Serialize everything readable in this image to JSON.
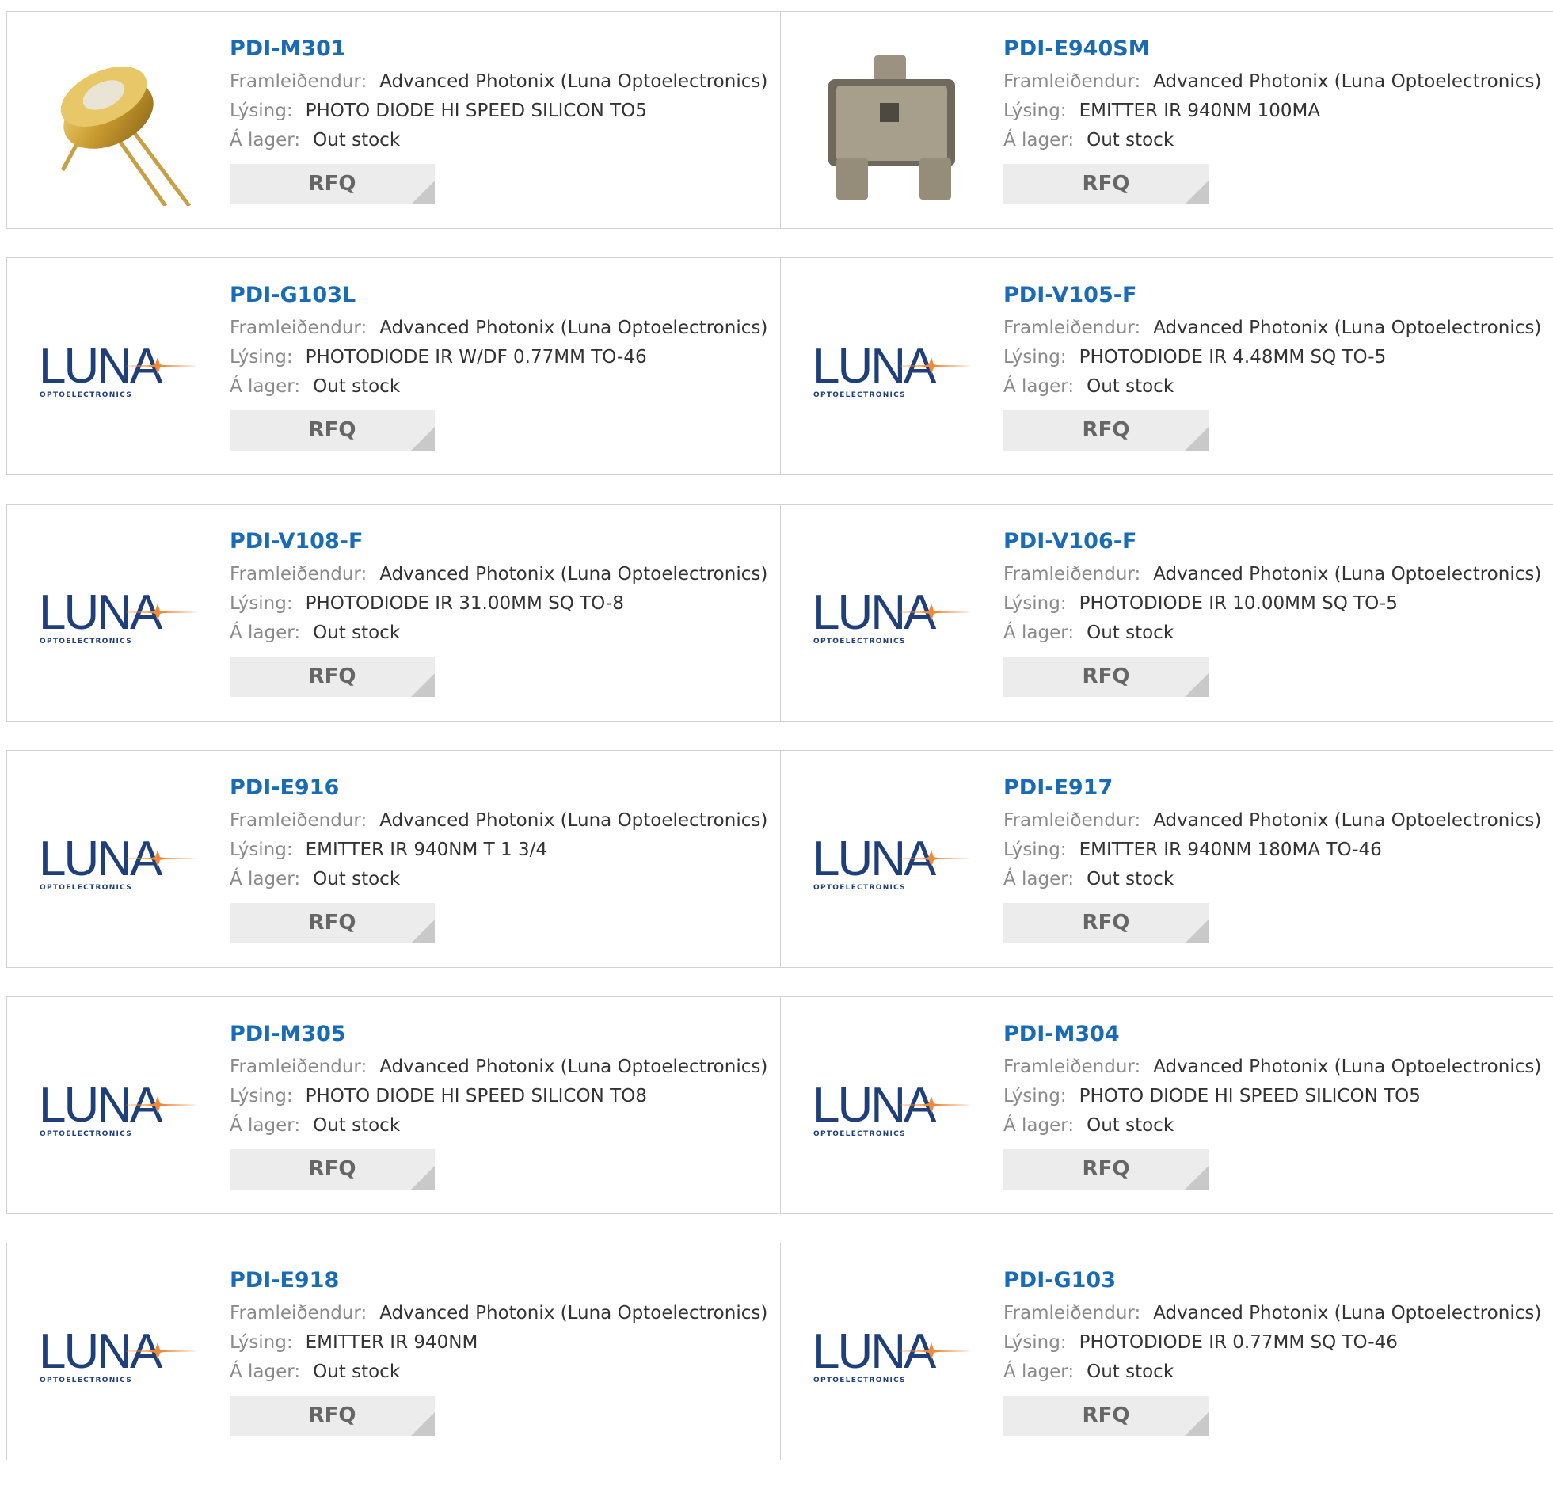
{
  "labels": {
    "manufacturer": "Framleiðendur:",
    "description": "Lýsing:",
    "stock": "Á lager:",
    "rfq": "RFQ"
  },
  "logo": {
    "word": "LUNA",
    "sub": "OPTOELECTRONICS"
  },
  "colors": {
    "link": "#1a6bb5",
    "logo_blue": "#1f3f7a",
    "logo_orange": "#f08a3a",
    "rfq_bg": "#ececec"
  },
  "products": [
    {
      "part": "PDI-M301",
      "manufacturer": "Advanced Photonix (Luna Optoelectronics)",
      "description": "PHOTO DIODE HI SPEED SILICON TO5",
      "stock": "Out stock",
      "image": "to5-gold-photodiode"
    },
    {
      "part": "PDI-E940SM",
      "manufacturer": "Advanced Photonix (Luna Optoelectronics)",
      "description": "EMITTER IR 940NM 100MA",
      "stock": "Out stock",
      "image": "sot23-emitter"
    },
    {
      "part": "PDI-G103L",
      "manufacturer": "Advanced Photonix (Luna Optoelectronics)",
      "description": "PHOTODIODE IR W/DF 0.77MM TO-46",
      "stock": "Out stock",
      "image": "luna-logo"
    },
    {
      "part": "PDI-V105-F",
      "manufacturer": "Advanced Photonix (Luna Optoelectronics)",
      "description": "PHOTODIODE IR 4.48MM SQ TO-5",
      "stock": "Out stock",
      "image": "luna-logo"
    },
    {
      "part": "PDI-V108-F",
      "manufacturer": "Advanced Photonix (Luna Optoelectronics)",
      "description": "PHOTODIODE IR 31.00MM SQ TO-8",
      "stock": "Out stock",
      "image": "luna-logo"
    },
    {
      "part": "PDI-V106-F",
      "manufacturer": "Advanced Photonix (Luna Optoelectronics)",
      "description": "PHOTODIODE IR 10.00MM SQ TO-5",
      "stock": "Out stock",
      "image": "luna-logo"
    },
    {
      "part": "PDI-E916",
      "manufacturer": "Advanced Photonix (Luna Optoelectronics)",
      "description": "EMITTER IR 940NM T 1 3/4",
      "stock": "Out stock",
      "image": "luna-logo"
    },
    {
      "part": "PDI-E917",
      "manufacturer": "Advanced Photonix (Luna Optoelectronics)",
      "description": "EMITTER IR 940NM 180MA TO-46",
      "stock": "Out stock",
      "image": "luna-logo"
    },
    {
      "part": "PDI-M305",
      "manufacturer": "Advanced Photonix (Luna Optoelectronics)",
      "description": "PHOTO DIODE HI SPEED SILICON TO8",
      "stock": "Out stock",
      "image": "luna-logo"
    },
    {
      "part": "PDI-M304",
      "manufacturer": "Advanced Photonix (Luna Optoelectronics)",
      "description": "PHOTO DIODE HI SPEED SILICON TO5",
      "stock": "Out stock",
      "image": "luna-logo"
    },
    {
      "part": "PDI-E918",
      "manufacturer": "Advanced Photonix (Luna Optoelectronics)",
      "description": "EMITTER IR 940NM",
      "stock": "Out stock",
      "image": "luna-logo"
    },
    {
      "part": "PDI-G103",
      "manufacturer": "Advanced Photonix (Luna Optoelectronics)",
      "description": "PHOTODIODE IR 0.77MM SQ TO-46",
      "stock": "Out stock",
      "image": "luna-logo"
    }
  ]
}
